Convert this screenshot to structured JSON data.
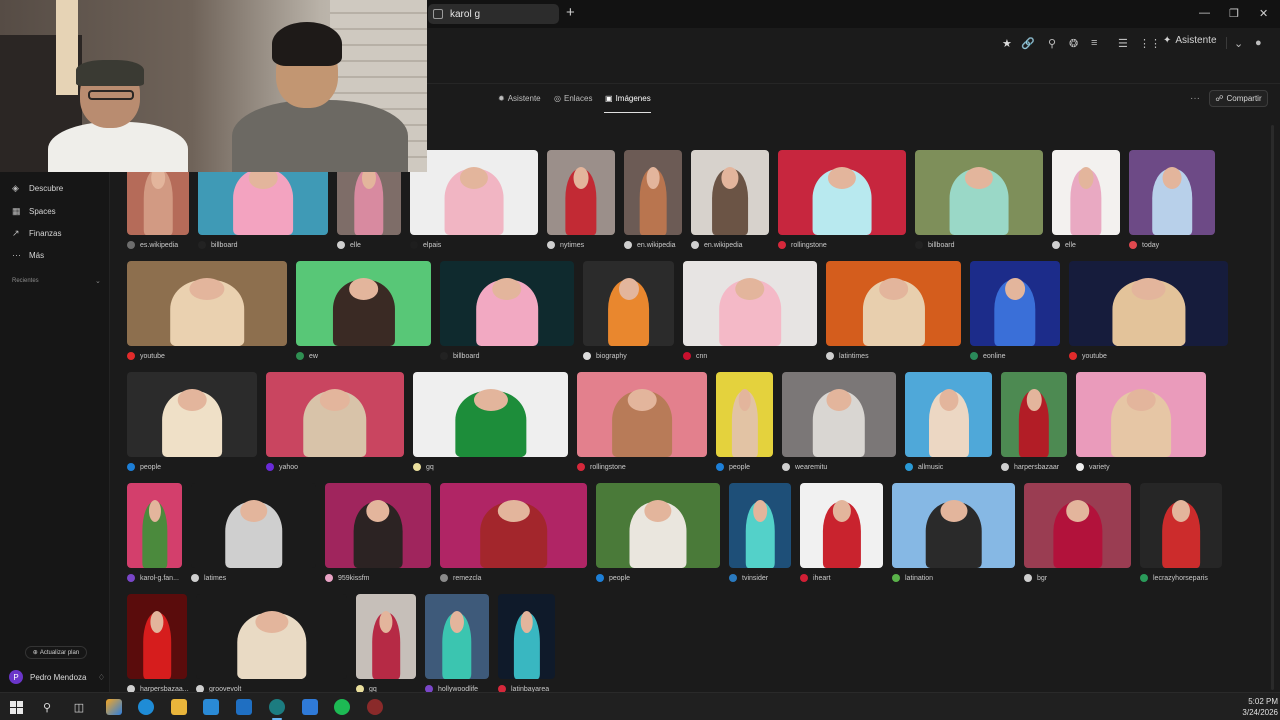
{
  "window": {
    "tab_title": "karol g",
    "new_tab": "+"
  },
  "toolbar": {
    "assistant_label": "Asistente"
  },
  "subnav": {
    "tabs": [
      {
        "label": "Asistente",
        "icon": "sparkle-icon"
      },
      {
        "label": "Enlaces",
        "icon": "globe-icon"
      },
      {
        "label": "Imágenes",
        "icon": "image-icon",
        "active": true
      }
    ],
    "share_label": "Compartir"
  },
  "sidebar": {
    "items": [
      {
        "label": "Descubre",
        "icon": "discover-icon"
      },
      {
        "label": "Spaces",
        "icon": "grid-icon"
      },
      {
        "label": "Finanzas",
        "icon": "chart-icon"
      },
      {
        "label": "Más",
        "icon": "more-icon"
      }
    ],
    "recientes": "Recientes",
    "upgrade": "Actualizar plan",
    "user_name": "Pedro Mendoza",
    "user_initial": "P"
  },
  "images": {
    "rows": [
      [
        {
          "src": "es.wikipedia",
          "bg": "#b56b59",
          "fig": "#d29a83",
          "icon": "#6d6d6d"
        },
        {
          "src": "billboard",
          "bg": "#3f9ab6",
          "fig": "#f3a3c0",
          "icon": "#222222"
        },
        {
          "src": "elle",
          "bg": "#7e6d68",
          "fig": "#d88aa0",
          "icon": "#cfcfcf"
        },
        {
          "src": "elpais",
          "bg": "#eeeeee",
          "fig": "#f1b5c3",
          "icon": "#1e1e1e"
        },
        {
          "src": "nytimes",
          "bg": "#9b8f8a",
          "fig": "#c22a34",
          "icon": "#cfcfcf"
        },
        {
          "src": "en.wikipedia",
          "bg": "#6c5b55",
          "fig": "#b9754f",
          "icon": "#cfcfcf"
        },
        {
          "src": "en.wikipedia",
          "bg": "#d7d2cc",
          "fig": "#6b5445",
          "icon": "#cfcfcf"
        },
        {
          "src": "rollingstone",
          "bg": "#c7263e",
          "fig": "#b8e9ef",
          "icon": "#d6283b"
        },
        {
          "src": "billboard",
          "bg": "#7e8f5a",
          "fig": "#9ad8c7",
          "icon": "#222222"
        },
        {
          "src": "elle",
          "bg": "#f3f1ef",
          "fig": "#e9a9c2",
          "icon": "#cfcfcf"
        },
        {
          "src": "today",
          "bg": "#6d4a86",
          "fig": "#b8d0ea",
          "icon": "#e0494f"
        }
      ],
      [
        {
          "src": "youtube",
          "bg": "#8d6f4e",
          "fig": "#ead1b0",
          "icon": "#e22b2b"
        },
        {
          "src": "ew",
          "bg": "#58c777",
          "fig": "#3a2a24",
          "icon": "#2f8f52"
        },
        {
          "src": "billboard",
          "bg": "#0f2a2e",
          "fig": "#f2a9c2",
          "icon": "#222222"
        },
        {
          "src": "biography",
          "bg": "#2b2b2b",
          "fig": "#e9872e",
          "icon": "#dddddd"
        },
        {
          "src": "cnn",
          "bg": "#e7e4e3",
          "fig": "#f4b9c7",
          "icon": "#c8102e"
        },
        {
          "src": "latintimes",
          "bg": "#d45d1d",
          "fig": "#e8cfae",
          "icon": "#cfcfcf"
        },
        {
          "src": "eonline",
          "bg": "#1c2c8a",
          "fig": "#3a6fd8",
          "icon": "#2a8a5a"
        },
        {
          "src": "youtube",
          "bg": "#161c3c",
          "fig": "#e3c39a",
          "icon": "#e22b2b"
        }
      ],
      [
        {
          "src": "people",
          "bg": "#2b2b2b",
          "fig": "#efe0c7",
          "icon": "#1d7fd7"
        },
        {
          "src": "yahoo",
          "bg": "#c94560",
          "fig": "#d8c3a9",
          "icon": "#6a2bd8"
        },
        {
          "src": "gq",
          "bg": "#efefef",
          "fig": "#1d8d3a",
          "icon": "#eadf9d"
        },
        {
          "src": "rollingstone",
          "bg": "#e3808d",
          "fig": "#b87b58",
          "icon": "#d6283b"
        },
        {
          "src": "people",
          "bg": "#e4d23d",
          "fig": "#e2c3a4",
          "icon": "#1d7fd7"
        },
        {
          "src": "wearemitu",
          "bg": "#7b7777",
          "fig": "#d9d6d2",
          "icon": "#cfcfcf"
        },
        {
          "src": "allmusic",
          "bg": "#4fa8d9",
          "fig": "#ecd7c3",
          "icon": "#2a9ad6"
        },
        {
          "src": "harpersbazaar",
          "bg": "#4d8a52",
          "fig": "#b21d26",
          "icon": "#cfcfcf"
        },
        {
          "src": "variety",
          "bg": "#ea9bbb",
          "fig": "#e6c6a5",
          "icon": "#eeeeee"
        }
      ],
      [
        {
          "src": "karol-g.fan...",
          "bg": "#d33f6c",
          "fig": "#4b8a3d",
          "icon": "#7a46c8"
        },
        {
          "src": "latimes",
          "bg": "#1b1b1b",
          "fig": "#cfcfcf",
          "icon": "#cfcfcf"
        },
        {
          "src": "959kissfm",
          "bg": "#a0255d",
          "fig": "#2c2323",
          "icon": "#e9a3c5"
        },
        {
          "src": "remezcla",
          "bg": "#b02565",
          "fig": "#a3262c",
          "icon": "#8a8a8a"
        },
        {
          "src": "people",
          "bg": "#4a7a39",
          "fig": "#eae6de",
          "icon": "#1d7fd7"
        },
        {
          "src": "tvinsider",
          "bg": "#1e4f78",
          "fig": "#53d1c9",
          "icon": "#2a7abf"
        },
        {
          "src": "iheart",
          "bg": "#f1f1f1",
          "fig": "#c9232e",
          "icon": "#d11f35"
        },
        {
          "src": "latination",
          "bg": "#86b8e4",
          "fig": "#2a2a2a",
          "icon": "#5ab24a"
        },
        {
          "src": "bgr",
          "bg": "#9a3d52",
          "fig": "#b2123b",
          "icon": "#cfcfcf"
        },
        {
          "src": "lecrazyhorseparis",
          "bg": "#262626",
          "fig": "#cc2c2c",
          "icon": "#2a9a5a"
        }
      ],
      [
        {
          "src": "harpersbazaa...",
          "bg": "#5a0c0c",
          "fig": "#d61d1d",
          "icon": "#cfcfcf"
        },
        {
          "src": "groovevolt",
          "bg": "#1b1b1b",
          "fig": "#e9dac4",
          "icon": "#cfcfcf"
        },
        {
          "src": "gq",
          "bg": "#c6bfb9",
          "fig": "#b62a45",
          "icon": "#eadf9d"
        },
        {
          "src": "hollywoodlife",
          "bg": "#3e5a7a",
          "fig": "#3bc5b0",
          "icon": "#7a46c8"
        },
        {
          "src": "latinbayarea",
          "bg": "#0f1a2a",
          "fig": "#39b7c1",
          "icon": "#d6283b"
        }
      ]
    ]
  },
  "taskbar": {
    "time": "5:02 PM",
    "date": "3/24/2026"
  }
}
